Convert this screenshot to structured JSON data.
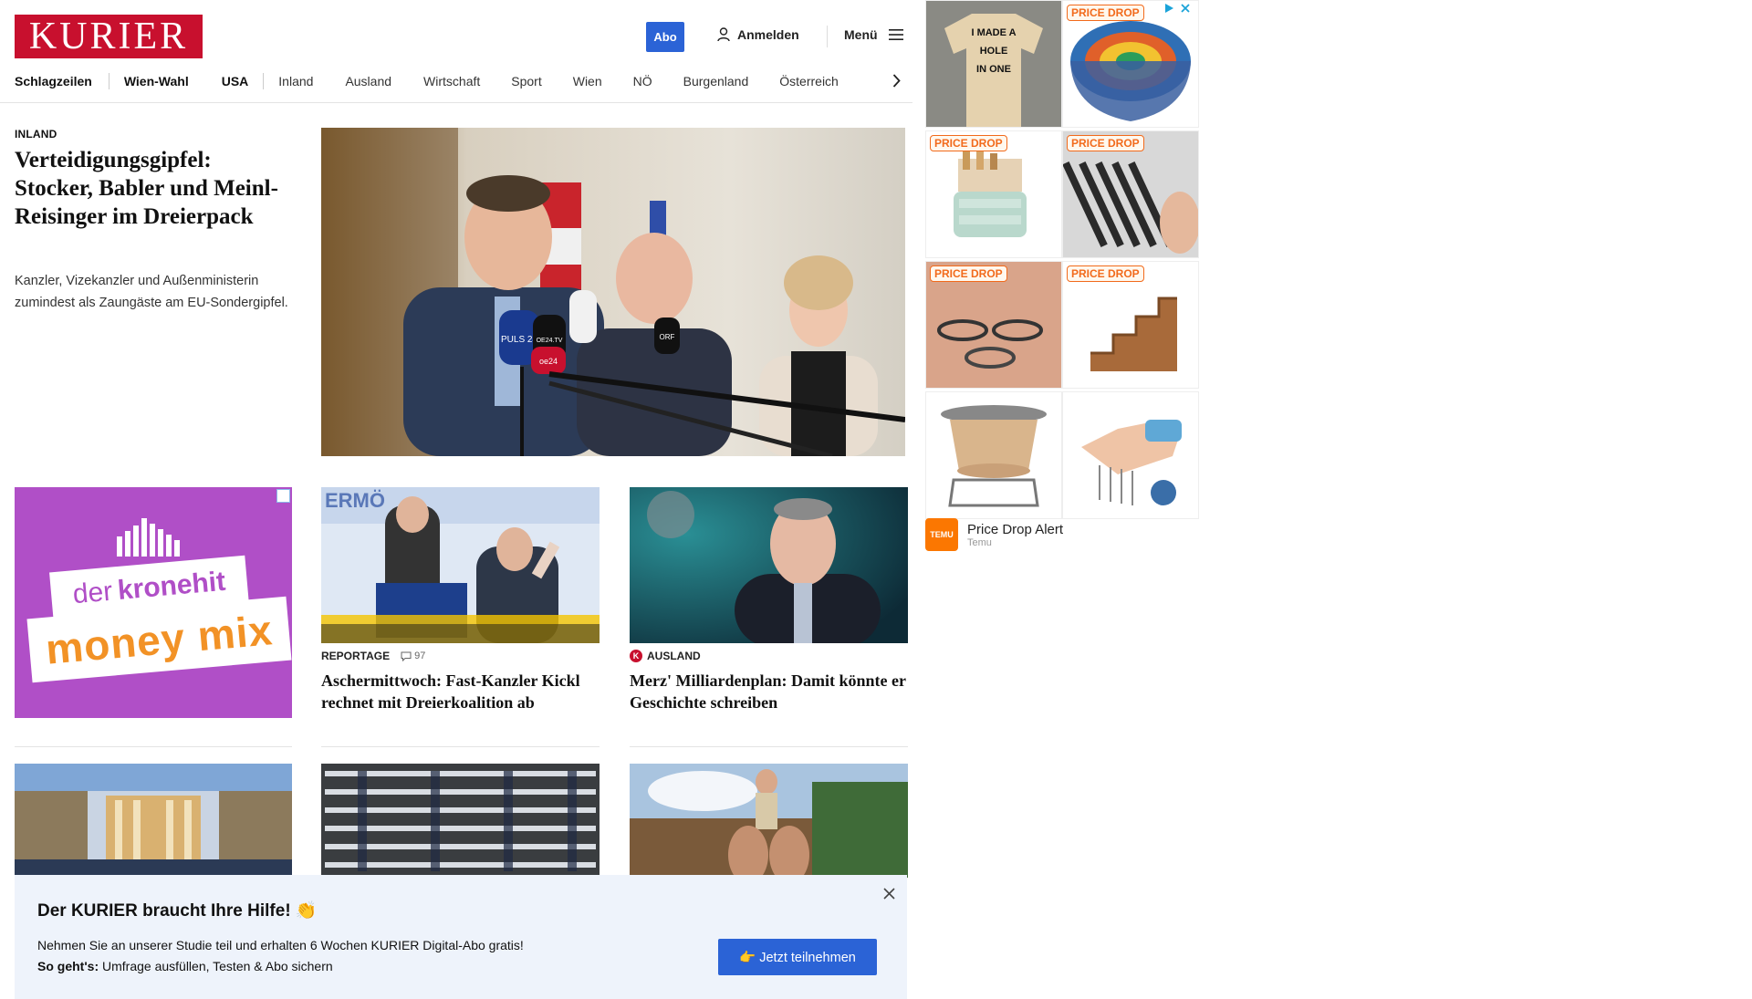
{
  "header": {
    "logo": "KURIER",
    "abo_label": "Abo",
    "login_label": "Anmelden",
    "menu_label": "Menü"
  },
  "nav": {
    "items": [
      "Schlagzeilen",
      "Wien-Wahl",
      "USA",
      "Inland",
      "Ausland",
      "Wirtschaft",
      "Sport",
      "Wien",
      "NÖ",
      "Burgenland",
      "Österreich"
    ]
  },
  "lead": {
    "kicker": "INLAND",
    "title": "Verteidigungsgipfel: Stocker, Babler und Meinl-Reisinger im Dreierpack",
    "subtitle": "Kanzler, Vizekanzler und Außenministerin zumindest als Zaungäste am EU-Sondergipfel.",
    "mic_labels": [
      "PULS 24",
      "OE24.TV",
      "oe24",
      "ORF"
    ]
  },
  "ad_krone": {
    "line1_a": "der",
    "line1_b": "kronehit",
    "line2": "money mix"
  },
  "cards": [
    {
      "kicker": "REPORTAGE",
      "comments": "97",
      "title": "Aschermittwoch: Fast-Kanzler Kickl rechnet mit Dreierkoalition ab"
    },
    {
      "kicker": "AUSLAND",
      "badge": "K",
      "title": "Merz' Milliardenplan: Damit könnte er Geschichte schreiben"
    }
  ],
  "banner": {
    "title": "Der KURIER braucht Ihre Hilfe! 👏",
    "text": "Nehmen Sie an unserer Studie teil und erhalten 6 Wochen KURIER Digital-Abo gratis!",
    "howto_label": "So geht's:",
    "howto_text": " Umfrage ausfüllen, Testen & Abo sichern",
    "button": "👉 Jetzt teilnehmen"
  },
  "ad_temu": {
    "badge": "PRICE DROP",
    "shirt_text": [
      "I MADE A",
      "HOLE",
      "IN ONE"
    ],
    "title": "Price Drop Alert",
    "brand": "Temu",
    "logo_text": "TEMU"
  },
  "colors": {
    "brand_red": "#c8102e",
    "accent_blue": "#2b63d6",
    "krone_purple": "#b04fc7",
    "temu_orange": "#fb7701"
  }
}
